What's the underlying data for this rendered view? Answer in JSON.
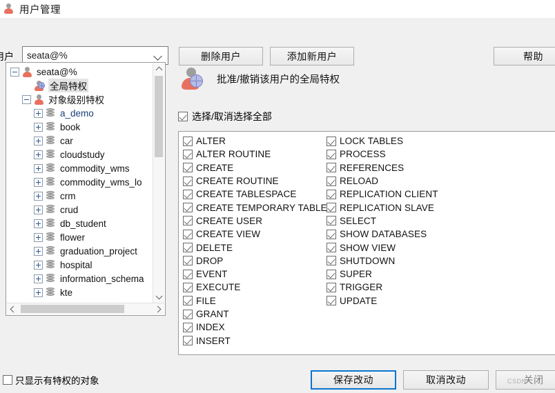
{
  "window": {
    "title": "用户管理",
    "title_icon": "user-icon"
  },
  "toolbar": {
    "user_label": "用户",
    "user_combo_value": "seata@%",
    "user_combo_icon": "chevron-down-icon",
    "delete_user_label": "删除用户",
    "add_user_label": "添加新用户",
    "help_label": "帮助"
  },
  "tree": {
    "nodes": [
      {
        "label": "seata@%",
        "indent": 0,
        "expander": "minus",
        "icon": "user-icon",
        "selected": false,
        "blue": false
      },
      {
        "label": "全局特权",
        "indent": 1,
        "expander": "none",
        "icon": "user-globe-icon",
        "selected": true,
        "blue": false
      },
      {
        "label": "对象级别特权",
        "indent": 1,
        "expander": "minus",
        "icon": "user-icon",
        "selected": false,
        "blue": false
      },
      {
        "label": "a_demo",
        "indent": 2,
        "expander": "plus",
        "icon": "database-icon",
        "selected": false,
        "blue": true
      },
      {
        "label": "book",
        "indent": 2,
        "expander": "plus",
        "icon": "database-icon",
        "selected": false,
        "blue": false
      },
      {
        "label": "car",
        "indent": 2,
        "expander": "plus",
        "icon": "database-icon",
        "selected": false,
        "blue": false
      },
      {
        "label": "cloudstudy",
        "indent": 2,
        "expander": "plus",
        "icon": "database-icon",
        "selected": false,
        "blue": false
      },
      {
        "label": "commodity_wms",
        "indent": 2,
        "expander": "plus",
        "icon": "database-icon",
        "selected": false,
        "blue": false
      },
      {
        "label": "commodity_wms_lo",
        "indent": 2,
        "expander": "plus",
        "icon": "database-icon",
        "selected": false,
        "blue": false
      },
      {
        "label": "crm",
        "indent": 2,
        "expander": "plus",
        "icon": "database-icon",
        "selected": false,
        "blue": false
      },
      {
        "label": "crud",
        "indent": 2,
        "expander": "plus",
        "icon": "database-icon",
        "selected": false,
        "blue": false
      },
      {
        "label": "db_student",
        "indent": 2,
        "expander": "plus",
        "icon": "database-icon",
        "selected": false,
        "blue": false
      },
      {
        "label": "flower",
        "indent": 2,
        "expander": "plus",
        "icon": "database-icon",
        "selected": false,
        "blue": false
      },
      {
        "label": "graduation_project",
        "indent": 2,
        "expander": "plus",
        "icon": "database-icon",
        "selected": false,
        "blue": false
      },
      {
        "label": "hospital",
        "indent": 2,
        "expander": "plus",
        "icon": "database-icon",
        "selected": false,
        "blue": false
      },
      {
        "label": "information_schema",
        "indent": 2,
        "expander": "plus",
        "icon": "database-icon",
        "selected": false,
        "blue": false
      },
      {
        "label": "kte",
        "indent": 2,
        "expander": "plus",
        "icon": "database-icon",
        "selected": false,
        "blue": false
      }
    ]
  },
  "privileges_panel": {
    "header_text": "批准/撤销该用户的全局特权",
    "header_icon": "user-globe-icon",
    "select_all_label": "选择/取消选择全部",
    "select_all_checked": true,
    "left_column": [
      {
        "label": "ALTER",
        "checked": true
      },
      {
        "label": "ALTER ROUTINE",
        "checked": true
      },
      {
        "label": "CREATE",
        "checked": true
      },
      {
        "label": "CREATE ROUTINE",
        "checked": true
      },
      {
        "label": "CREATE TABLESPACE",
        "checked": true
      },
      {
        "label": "CREATE TEMPORARY TABLES",
        "checked": true
      },
      {
        "label": "CREATE USER",
        "checked": true
      },
      {
        "label": "CREATE VIEW",
        "checked": true
      },
      {
        "label": "DELETE",
        "checked": true
      },
      {
        "label": "DROP",
        "checked": true
      },
      {
        "label": "EVENT",
        "checked": true
      },
      {
        "label": "EXECUTE",
        "checked": true
      },
      {
        "label": "FILE",
        "checked": true
      },
      {
        "label": "GRANT",
        "checked": true
      },
      {
        "label": "INDEX",
        "checked": true
      },
      {
        "label": "INSERT",
        "checked": true
      }
    ],
    "right_column": [
      {
        "label": "LOCK TABLES",
        "checked": true
      },
      {
        "label": "PROCESS",
        "checked": true
      },
      {
        "label": "REFERENCES",
        "checked": true
      },
      {
        "label": "RELOAD",
        "checked": true
      },
      {
        "label": "REPLICATION CLIENT",
        "checked": true
      },
      {
        "label": "REPLICATION SLAVE",
        "checked": true
      },
      {
        "label": "SELECT",
        "checked": true
      },
      {
        "label": "SHOW DATABASES",
        "checked": true
      },
      {
        "label": "SHOW VIEW",
        "checked": true
      },
      {
        "label": "SHUTDOWN",
        "checked": true
      },
      {
        "label": "SUPER",
        "checked": true
      },
      {
        "label": "TRIGGER",
        "checked": true
      },
      {
        "label": "UPDATE",
        "checked": true
      }
    ]
  },
  "footer": {
    "only_privileged_label": "只显示有特权的对象",
    "only_privileged_checked": false,
    "save_label": "保存改动",
    "cancel_label": "取消改动",
    "close_label": "关闭",
    "watermark": "CSDN"
  },
  "colors": {
    "accent": "#0a73d0",
    "person_icon": "#e8705f",
    "window_bg": "#f0f0f0",
    "panel_bg": "#ffffff"
  }
}
